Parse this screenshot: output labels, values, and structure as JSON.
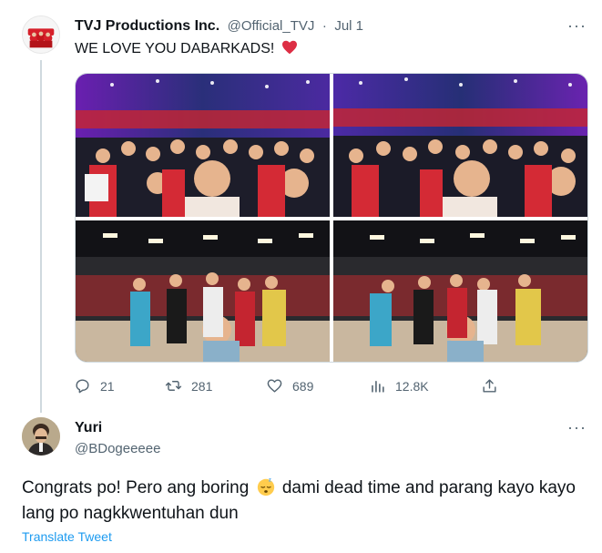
{
  "tweet": {
    "author_name": "TVJ Productions Inc.",
    "handle": "@Official_TVJ",
    "separator": "·",
    "date": "Jul 1",
    "text": "WE LOVE YOU DABARKADS!",
    "heart_emoji": "❤️",
    "more": "···",
    "avatar_icon": "tvj-logo-avatar",
    "media": [
      {
        "name": "group-selfie-photo-1"
      },
      {
        "name": "group-selfie-photo-2"
      },
      {
        "name": "studio-selfie-photo-3"
      },
      {
        "name": "studio-selfie-photo-4"
      }
    ],
    "actions": {
      "replies": "21",
      "retweets": "281",
      "likes": "689",
      "views": "12.8K"
    }
  },
  "reply": {
    "author_name": "Yuri",
    "handle": "@BDogeeeee",
    "more": "···",
    "text_before_emoji": "Congrats po! Pero ang boring",
    "emoji": "sleeping-face",
    "text_after_emoji": "dami dead time and parang kayo kayo lang po nagkkwentuhan dun",
    "translate_label": "Translate Tweet"
  },
  "colors": {
    "link": "#1d9bf0",
    "muted": "#536471",
    "text": "#0f1419",
    "heart": "#f91880"
  }
}
